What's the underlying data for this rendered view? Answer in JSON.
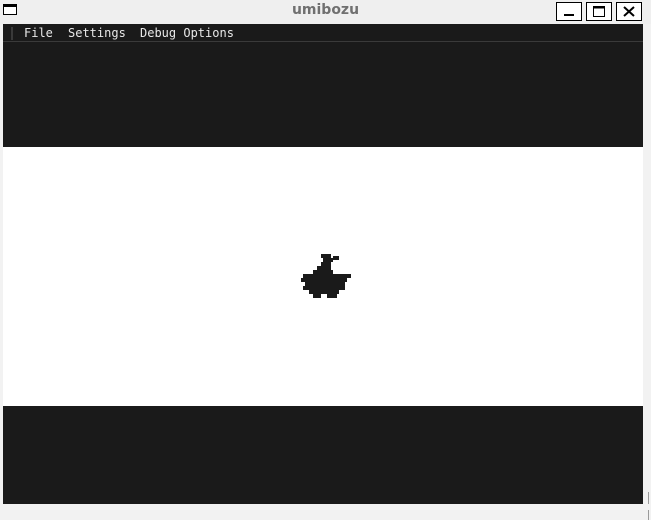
{
  "window": {
    "title": "umibozu",
    "icon": "window-menu-icon",
    "controls": [
      "minimize-icon",
      "maximize-icon",
      "close-icon"
    ]
  },
  "menu": {
    "items": [
      {
        "label": "File"
      },
      {
        "label": "Settings"
      },
      {
        "label": "Debug Options"
      }
    ]
  },
  "game": {
    "sprite": "umibozu-sprite",
    "colors": {
      "border": "#1a1a1a",
      "playfield": "#ffffff",
      "sprite": "#1a1a1a"
    }
  }
}
